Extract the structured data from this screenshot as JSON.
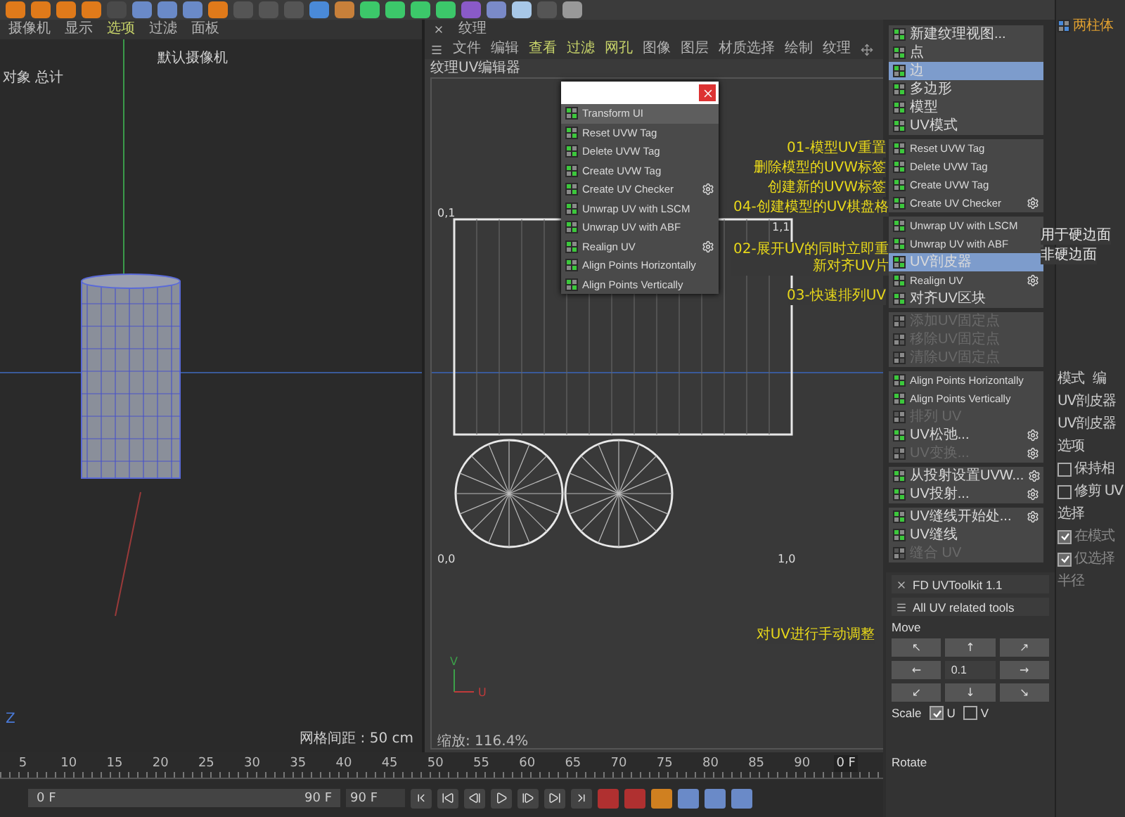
{
  "viewport": {
    "menu": [
      {
        "label": "摄像机",
        "highlighted": false
      },
      {
        "label": "显示",
        "highlighted": false
      },
      {
        "label": "选项",
        "highlighted": true
      },
      {
        "label": "过滤",
        "highlighted": false
      },
      {
        "label": "面板",
        "highlighted": false
      }
    ],
    "camera_label": "默认摄像机",
    "object_label": "对象 总计",
    "axis_label": "Z",
    "grid_spacing": "网格间距 : 50 cm"
  },
  "uv_editor": {
    "tab_title": "纹理",
    "menu": [
      {
        "label": "文件",
        "highlighted": false
      },
      {
        "label": "编辑",
        "highlighted": false
      },
      {
        "label": "查看",
        "highlighted": true
      },
      {
        "label": "过滤",
        "highlighted": true
      },
      {
        "label": "网孔",
        "highlighted": true
      },
      {
        "label": "图像",
        "highlighted": false
      },
      {
        "label": "图层",
        "highlighted": false
      },
      {
        "label": "材质选择",
        "highlighted": false
      },
      {
        "label": "绘制",
        "highlighted": false
      },
      {
        "label": "纹理",
        "highlighted": false
      }
    ],
    "title": "纹理UV编辑器",
    "corner_labels": [
      "0,1",
      "1,1",
      "0,0",
      "1,0"
    ],
    "axis_v": "V",
    "axis_u": "U",
    "zoom": "缩放: 116.4%"
  },
  "popup": {
    "items": [
      {
        "label": "Transform UI",
        "selected": true,
        "settings": false
      },
      {
        "label": "Reset UVW Tag",
        "selected": false,
        "settings": false
      },
      {
        "label": "Delete UVW Tag",
        "selected": false,
        "settings": false
      },
      {
        "label": "Create UVW Tag",
        "selected": false,
        "settings": false
      },
      {
        "label": "Create UV Checker",
        "selected": false,
        "settings": true
      },
      {
        "label": "Unwrap UV with LSCM",
        "selected": false,
        "settings": false
      },
      {
        "label": "Unwrap UV with ABF",
        "selected": false,
        "settings": false
      },
      {
        "label": "Realign UV",
        "selected": false,
        "settings": true
      },
      {
        "label": "Align Points Horizontally",
        "selected": false,
        "settings": false
      },
      {
        "label": "Align Points Vertically",
        "selected": false,
        "settings": false
      }
    ]
  },
  "annotations": [
    {
      "text": "01-模型UV重置",
      "color": "#e8d81a"
    },
    {
      "text": "删除模型的UVW标签",
      "color": "#e8d81a"
    },
    {
      "text": "创建新的UVW标签",
      "color": "#e8d81a"
    },
    {
      "text": "04-创建模型的UV棋盘格",
      "color": "#e8d81a"
    },
    {
      "text": "02-展开UV的同时立即重新对齐UV片",
      "color": "#e8d81a"
    },
    {
      "text": "03-快速排列UV",
      "color": "#e8d81a"
    },
    {
      "text": "用于硬边面",
      "color": "#e8e8e8"
    },
    {
      "text": "非硬边面",
      "color": "#e8e8e8"
    },
    {
      "text": "对UV进行手动调整",
      "color": "#e8d81a"
    }
  ],
  "palette": {
    "groups": [
      {
        "items": [
          {
            "label": "新建纹理视图...",
            "selected": false,
            "disabled": false,
            "settings": false
          },
          {
            "label": "点",
            "selected": false,
            "disabled": false,
            "settings": false
          },
          {
            "label": "边",
            "selected": true,
            "disabled": false,
            "settings": false
          },
          {
            "label": "多边形",
            "selected": false,
            "disabled": false,
            "settings": false
          },
          {
            "label": "模型",
            "selected": false,
            "disabled": false,
            "settings": false
          },
          {
            "label": "UV模式",
            "selected": false,
            "disabled": false,
            "settings": false
          }
        ]
      },
      {
        "items": [
          {
            "label": "Reset UVW Tag",
            "selected": false,
            "disabled": false,
            "settings": false
          },
          {
            "label": "Delete UVW Tag",
            "selected": false,
            "disabled": false,
            "settings": false
          },
          {
            "label": "Create UVW Tag",
            "selected": false,
            "disabled": false,
            "settings": false
          },
          {
            "label": "Create UV Checker",
            "selected": false,
            "disabled": false,
            "settings": true
          }
        ]
      },
      {
        "items": [
          {
            "label": "Unwrap UV with LSCM",
            "selected": false,
            "disabled": false,
            "settings": false
          },
          {
            "label": "Unwrap UV with ABF",
            "selected": false,
            "disabled": false,
            "settings": false
          },
          {
            "label": "UV剖皮器",
            "selected": true,
            "disabled": false,
            "settings": false
          },
          {
            "label": "Realign UV",
            "selected": false,
            "disabled": false,
            "settings": true
          },
          {
            "label": "对齐UV区块",
            "selected": false,
            "disabled": false,
            "settings": false
          }
        ]
      },
      {
        "items": [
          {
            "label": "添加UV固定点",
            "selected": false,
            "disabled": true,
            "settings": false
          },
          {
            "label": "移除UV固定点",
            "selected": false,
            "disabled": true,
            "settings": false
          },
          {
            "label": "清除UV固定点",
            "selected": false,
            "disabled": true,
            "settings": false
          }
        ]
      },
      {
        "items": [
          {
            "label": "Align Points Horizontally",
            "selected": false,
            "disabled": false,
            "settings": false
          },
          {
            "label": "Align Points Vertically",
            "selected": false,
            "disabled": false,
            "settings": false
          },
          {
            "label": "排列 UV",
            "selected": false,
            "disabled": true,
            "settings": false
          },
          {
            "label": "UV松弛...",
            "selected": false,
            "disabled": false,
            "settings": true
          },
          {
            "label": "UV变换...",
            "selected": false,
            "disabled": true,
            "settings": true
          }
        ]
      },
      {
        "items": [
          {
            "label": "从投射设置UVW...",
            "selected": false,
            "disabled": false,
            "settings": true
          },
          {
            "label": "UV投射...",
            "selected": false,
            "disabled": false,
            "settings": true
          }
        ]
      },
      {
        "items": [
          {
            "label": "UV缝线开始处...",
            "selected": false,
            "disabled": false,
            "settings": true
          },
          {
            "label": "UV缝线",
            "selected": false,
            "disabled": false,
            "settings": false
          },
          {
            "label": "缝合 UV",
            "selected": false,
            "disabled": true,
            "settings": false
          }
        ]
      }
    ]
  },
  "toolkit": {
    "title": "FD UVToolkit 1.1",
    "subtitle": "All UV related tools",
    "move_label": "Move",
    "move_buttons": [
      "↖",
      "↑",
      "↗",
      "←",
      "→",
      "↙",
      "↓",
      "↘"
    ],
    "move_value": "0.1",
    "scale_label": "Scale",
    "scale_options": [
      {
        "label": "U",
        "checked": true
      },
      {
        "label": "V",
        "checked": false
      }
    ],
    "rotate_label": "Rotate"
  },
  "object_tree": {
    "object": "两柱体"
  },
  "attributes": {
    "menu": [
      "模式",
      "编"
    ],
    "object": "UV剖皮器",
    "title": "UV剖皮器",
    "tab": "选项",
    "options": [
      {
        "label": "保持相",
        "checked": false
      },
      {
        "label": "修剪 UV",
        "checked": false
      }
    ],
    "section": "选择",
    "sub_options": [
      {
        "label": "在模式",
        "checked": true
      },
      {
        "label": "仅选择",
        "checked": true
      }
    ],
    "radius_label": "半径"
  },
  "timeline": {
    "ticks": [
      "5",
      "10",
      "15",
      "20",
      "25",
      "30",
      "35",
      "40",
      "45",
      "50",
      "55",
      "60",
      "65",
      "70",
      "75",
      "80",
      "85",
      "90"
    ],
    "current_frame": "0 F",
    "range_start": "0 F",
    "range_end": "90 F",
    "end_frame": "90 F"
  }
}
